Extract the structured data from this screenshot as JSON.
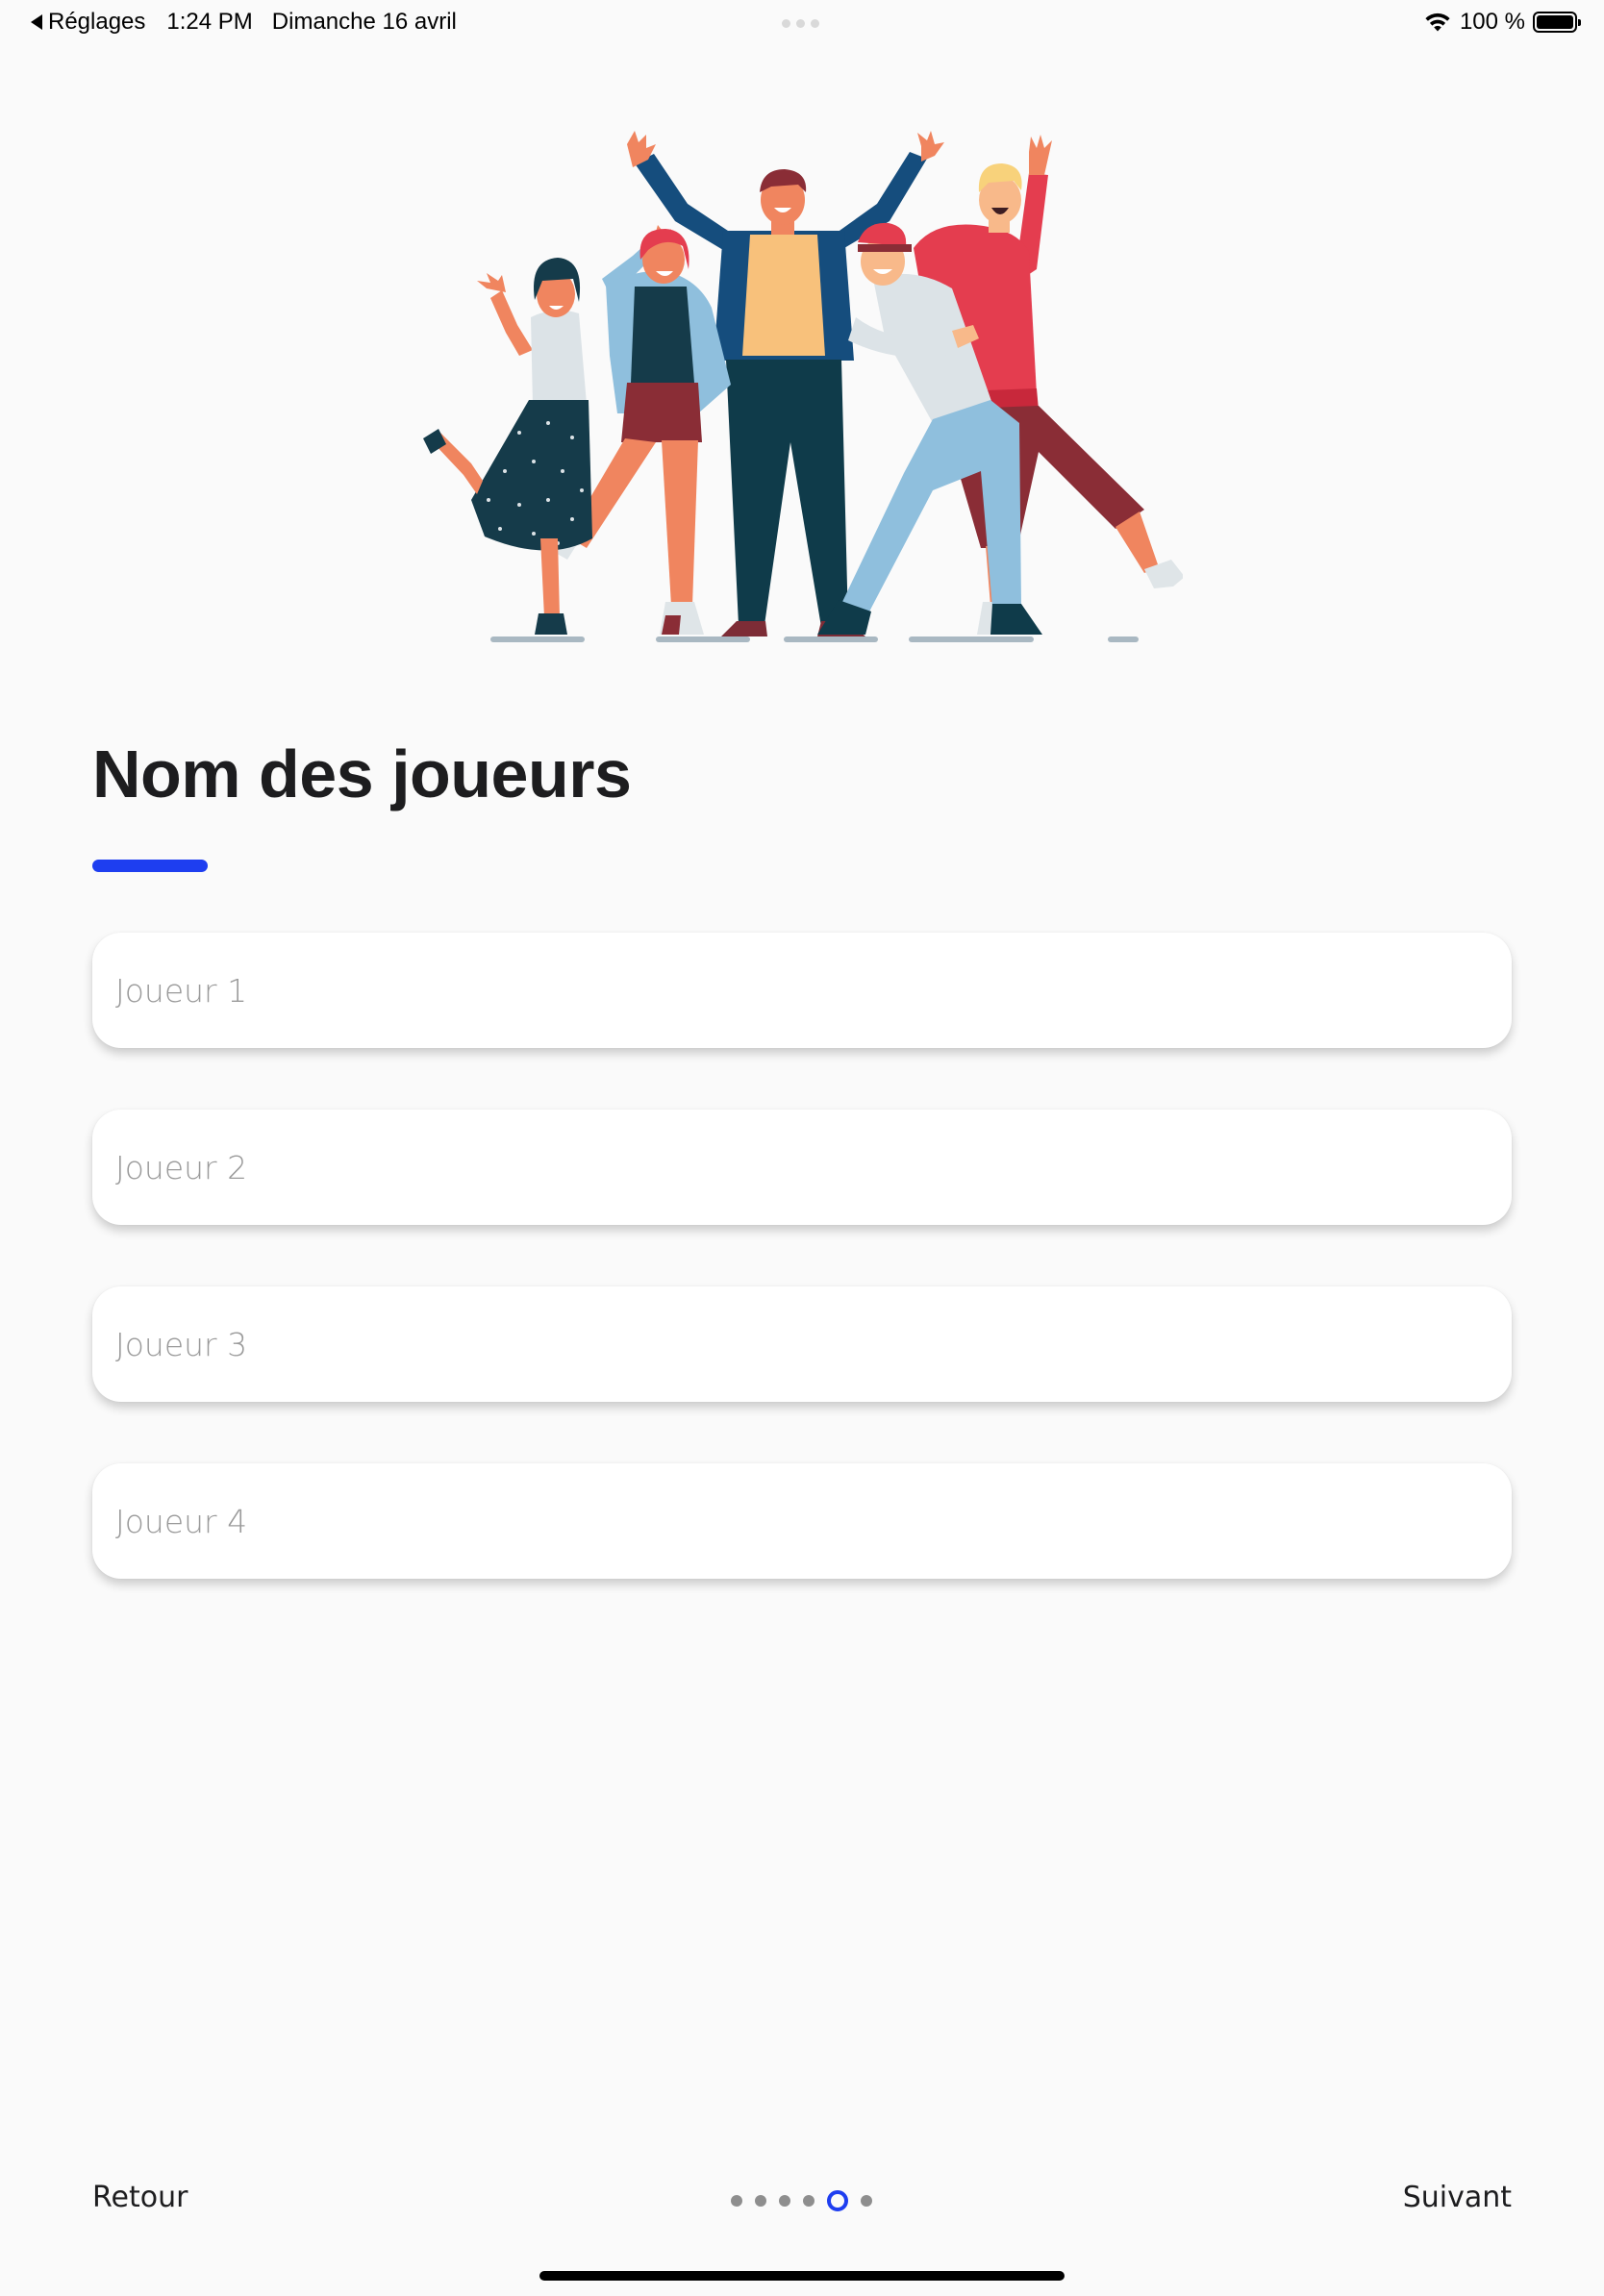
{
  "status_bar": {
    "back_app": "Réglages",
    "time": "1:24 PM",
    "date": "Dimanche 16 avril",
    "battery": "100 %",
    "icons": [
      "back-arrow-icon",
      "wifi-icon",
      "battery-icon"
    ]
  },
  "illustration": {
    "icon": "group-of-friends-illustration"
  },
  "heading": {
    "title": "Nom des joueurs"
  },
  "players": [
    {
      "placeholder": "Joueur 1",
      "value": ""
    },
    {
      "placeholder": "Joueur 2",
      "value": ""
    },
    {
      "placeholder": "Joueur 3",
      "value": ""
    },
    {
      "placeholder": "Joueur 4",
      "value": ""
    }
  ],
  "footer": {
    "back_label": "Retour",
    "next_label": "Suivant",
    "pager": {
      "total": 6,
      "current": 5
    }
  },
  "colors": {
    "accent": "#1e3ef0",
    "background": "#fafafa",
    "field_bg": "#ffffff",
    "placeholder": "#9a9a9a"
  }
}
